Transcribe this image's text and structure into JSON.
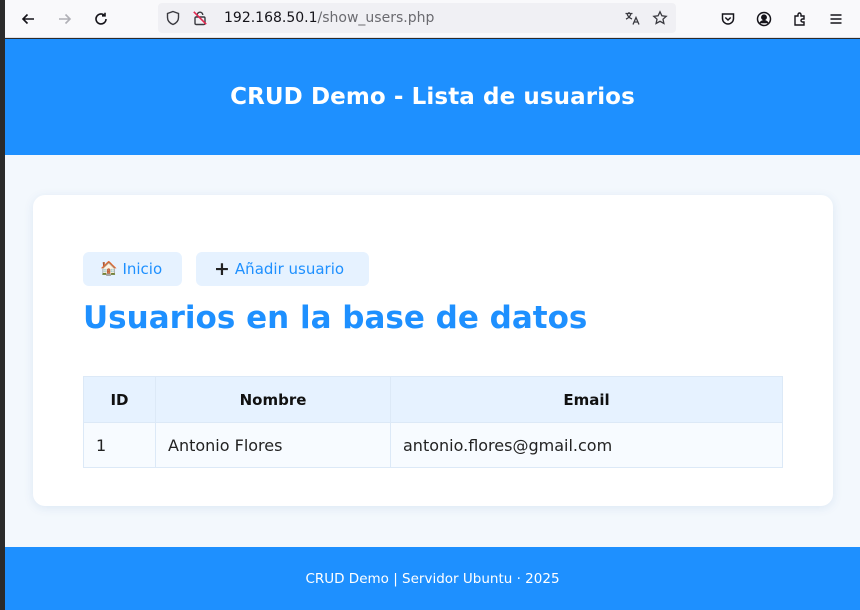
{
  "browser": {
    "url_host": "192.168.50.1",
    "url_path": "/show_users.php",
    "icons": [
      "back-icon",
      "forward-icon",
      "reload-icon",
      "shield-icon",
      "insecure-lock-icon",
      "translate-icon",
      "bookmark-star-icon",
      "pocket-icon",
      "account-icon",
      "extensions-icon",
      "menu-icon"
    ]
  },
  "header": {
    "title": "CRUD Demo - Lista de usuarios"
  },
  "actions": {
    "home_icon": "🏠",
    "home_label": "Inicio",
    "add_icon": "+",
    "add_label": "Añadir usuario"
  },
  "main": {
    "title": "Usuarios en la base de datos"
  },
  "table": {
    "headers": [
      "ID",
      "Nombre",
      "Email"
    ],
    "rows": [
      [
        "1",
        "Antonio Flores",
        "antonio.flores@gmail.com"
      ]
    ]
  },
  "footer": {
    "text": "CRUD Demo | Servidor Ubuntu · 2025"
  },
  "colors": {
    "primary": "#1e90ff",
    "background": "#f3f8fd",
    "button_bg": "#e6f2ff"
  }
}
